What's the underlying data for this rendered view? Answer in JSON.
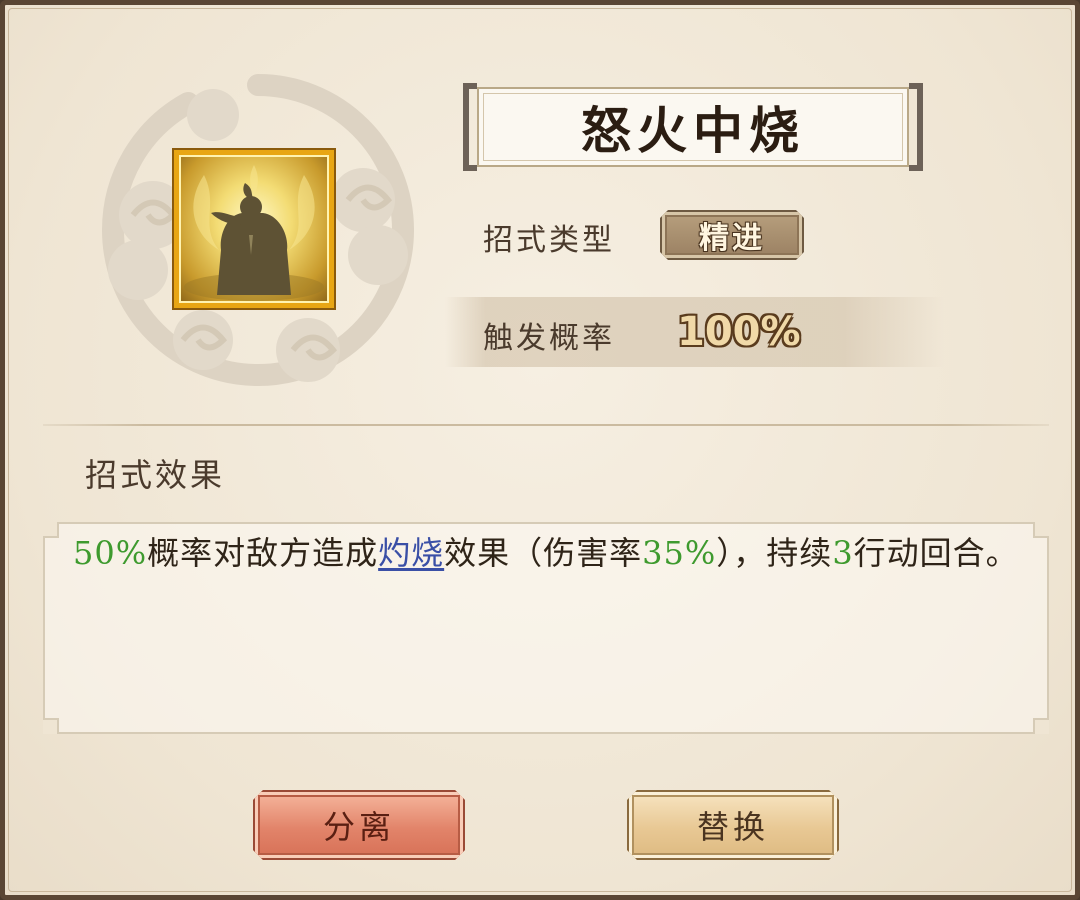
{
  "skill": {
    "name": "怒火中烧",
    "icon": "meditating-figure-flame-icon"
  },
  "info": {
    "type_label": "招式类型",
    "type_value": "精进",
    "rate_label": "触发概率",
    "rate_value": "100%"
  },
  "effect": {
    "heading": "招式效果",
    "segments": {
      "s1": "50%",
      "s2": "概率对敌方造成",
      "s3": "灼烧",
      "s4": "效果（伤害率",
      "s5": "35%",
      "s6": "），持续",
      "s7": "3",
      "s8": "行动回合。"
    }
  },
  "buttons": {
    "split": "分离",
    "replace": "替换"
  },
  "colors": {
    "highlight_green": "#3e9a2e",
    "keyword_blue": "#3a4fa6",
    "icon_border": "#e8a614"
  }
}
